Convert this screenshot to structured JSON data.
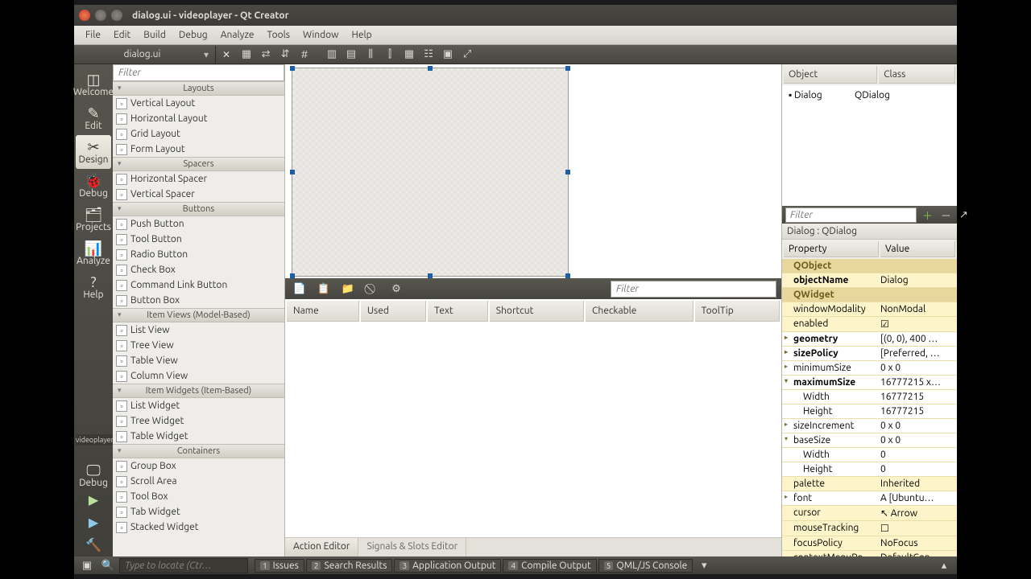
{
  "window": {
    "title": "dialog.ui - videoplayer - Qt Creator"
  },
  "menu": [
    "File",
    "Edit",
    "Build",
    "Debug",
    "Analyze",
    "Tools",
    "Window",
    "Help"
  ],
  "doc_tab": "dialog.ui",
  "modes": [
    {
      "label": "Welcome",
      "icon": "◫"
    },
    {
      "label": "Edit",
      "icon": "✎"
    },
    {
      "label": "Design",
      "icon": "✂",
      "active": true
    },
    {
      "label": "Debug",
      "icon": "🐞"
    },
    {
      "label": "Projects",
      "icon": "🗂"
    },
    {
      "label": "Analyze",
      "icon": "📊"
    },
    {
      "label": "Help",
      "icon": "?"
    }
  ],
  "project_selector": "videoplayer",
  "debug_selector": "Debug",
  "widgetbox": {
    "filter": "Filter",
    "groups": [
      {
        "name": "Layouts",
        "items": [
          "Vertical Layout",
          "Horizontal Layout",
          "Grid Layout",
          "Form Layout"
        ]
      },
      {
        "name": "Spacers",
        "items": [
          "Horizontal Spacer",
          "Vertical Spacer"
        ]
      },
      {
        "name": "Buttons",
        "items": [
          "Push Button",
          "Tool Button",
          "Radio Button",
          "Check Box",
          "Command Link Button",
          "Button Box"
        ]
      },
      {
        "name": "Item Views (Model-Based)",
        "items": [
          "List View",
          "Tree View",
          "Table View",
          "Column View"
        ]
      },
      {
        "name": "Item Widgets (Item-Based)",
        "items": [
          "List Widget",
          "Tree Widget",
          "Table Widget"
        ]
      },
      {
        "name": "Containers",
        "items": [
          "Group Box",
          "Scroll Area",
          "Tool Box",
          "Tab Widget",
          "Stacked Widget"
        ]
      }
    ]
  },
  "action_editor": {
    "filter": "Filter",
    "columns": [
      "Name",
      "Used",
      "Text",
      "Shortcut",
      "Checkable",
      "ToolTip"
    ],
    "tabs": [
      "Action Editor",
      "Signals & Slots Editor"
    ]
  },
  "object_inspector": {
    "columns": [
      "Object",
      "Class"
    ],
    "rows": [
      {
        "object": "Dialog",
        "class": "QDialog"
      }
    ]
  },
  "property_editor": {
    "filter": "Filter",
    "breadcrumb": "Dialog : QDialog",
    "columns": [
      "Property",
      "Value"
    ],
    "rows": [
      {
        "t": "grp",
        "k": "QObject"
      },
      {
        "t": "p",
        "k": "objectName",
        "v": "Dialog",
        "bold": true
      },
      {
        "t": "grp",
        "k": "QWidget"
      },
      {
        "t": "p",
        "k": "windowModality",
        "v": "NonModal"
      },
      {
        "t": "p",
        "k": "enabled",
        "v": "☑"
      },
      {
        "t": "exp",
        "k": "geometry",
        "v": "[(0, 0), 400 …",
        "bold": true
      },
      {
        "t": "exp",
        "k": "sizePolicy",
        "v": "[Preferred, …",
        "bold": true
      },
      {
        "t": "exp",
        "k": "minimumSize",
        "v": "0 x 0"
      },
      {
        "t": "open",
        "k": "maximumSize",
        "v": "16777215 x…",
        "bold": true
      },
      {
        "t": "sub",
        "k": "Width",
        "v": "16777215"
      },
      {
        "t": "sub",
        "k": "Height",
        "v": "16777215"
      },
      {
        "t": "exp",
        "k": "sizeIncrement",
        "v": "0 x 0"
      },
      {
        "t": "open",
        "k": "baseSize",
        "v": "0 x 0"
      },
      {
        "t": "sub",
        "k": "Width",
        "v": "0"
      },
      {
        "t": "sub",
        "k": "Height",
        "v": "0"
      },
      {
        "t": "p",
        "k": "palette",
        "v": "Inherited"
      },
      {
        "t": "exp",
        "k": "font",
        "v": "A  [Ubuntu…"
      },
      {
        "t": "p",
        "k": "cursor",
        "v": "↖  Arrow"
      },
      {
        "t": "p",
        "k": "mouseTracking",
        "v": "☐"
      },
      {
        "t": "p",
        "k": "focusPolicy",
        "v": "NoFocus"
      },
      {
        "t": "p",
        "k": "contextMenuPo…",
        "v": "DefaultCon…"
      }
    ]
  },
  "status": {
    "locator": "Type to locate (Ctr…",
    "panes": [
      [
        "1",
        "Issues"
      ],
      [
        "2",
        "Search Results"
      ],
      [
        "3",
        "Application Output"
      ],
      [
        "4",
        "Compile Output"
      ],
      [
        "5",
        "QML/JS Console"
      ]
    ]
  }
}
